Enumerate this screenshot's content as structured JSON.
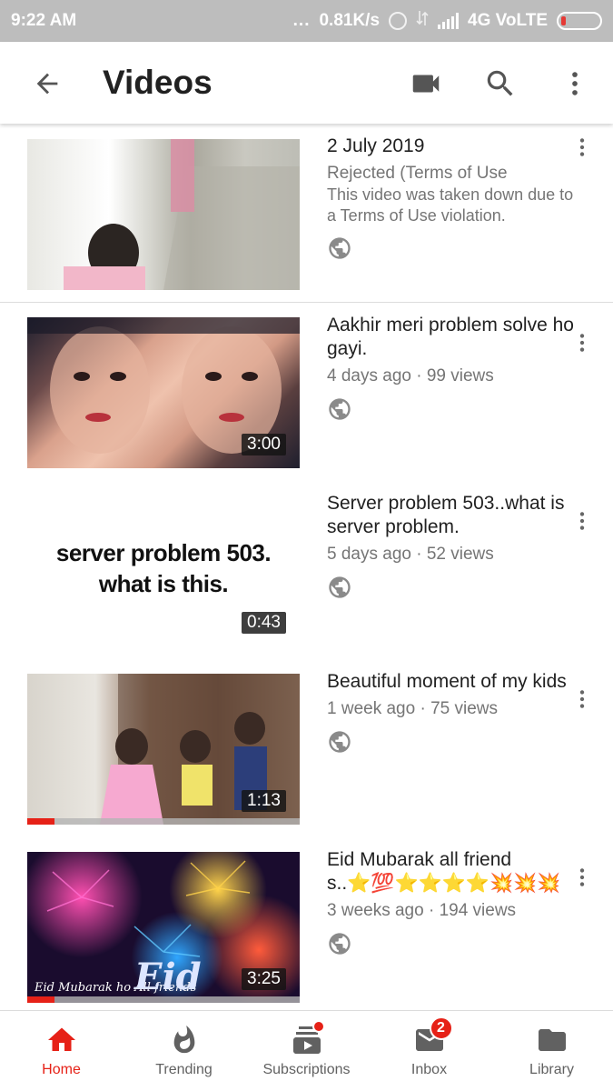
{
  "status_bar": {
    "time": "9:22 AM",
    "dots": "...",
    "speed": "0.81K/s",
    "network": "4G VoLTE"
  },
  "app_bar": {
    "title": "Videos",
    "icons": [
      "arrow-back-icon",
      "videocam-icon",
      "search-icon",
      "more-vert-icon"
    ]
  },
  "videos": [
    {
      "title": "2 July 2019",
      "status": "Rejected (Terms of Use",
      "description": "This video was taken down due to a Terms of Use violation.",
      "visibility_icon": "globe-icon"
    },
    {
      "title": "Aakhir meri problem solve ho gayi.",
      "meta": "4 days ago · 99 views",
      "duration": "3:00",
      "visibility_icon": "globe-icon"
    },
    {
      "title": "Server problem 503..what is server problem.",
      "meta": "5 days ago · 52 views",
      "duration": "0:43",
      "thumbnail_text": "server problem 503. what is this.",
      "visibility_icon": "globe-icon"
    },
    {
      "title": "Beautiful moment of my kids",
      "meta": "1 week ago · 75 views",
      "duration": "1:13",
      "watched_fraction": 0.1,
      "visibility_icon": "globe-icon"
    },
    {
      "title": "Eid Mubarak all friend s..⭐💯⭐⭐⭐⭐💥💥💥",
      "meta": "3 weeks ago · 194 views",
      "duration": "3:25",
      "thumbnail_caption": "Eid Mubarak ho All friends",
      "thumbnail_text": "Eid",
      "watched_fraction": 0.1,
      "visibility_icon": "globe-icon"
    }
  ],
  "bottom_nav": {
    "items": [
      {
        "label": "Home",
        "icon": "home-icon",
        "active": true
      },
      {
        "label": "Trending",
        "icon": "flame-icon"
      },
      {
        "label": "Subscriptions",
        "icon": "subscriptions-icon",
        "badge_dot": true
      },
      {
        "label": "Inbox",
        "icon": "mail-icon",
        "badge": "2"
      },
      {
        "label": "Library",
        "icon": "folder-icon"
      }
    ]
  },
  "colors": {
    "accent": "#e62117",
    "status_bar": "#bdbdbd",
    "text_primary": "#212121",
    "text_secondary": "#757575"
  }
}
